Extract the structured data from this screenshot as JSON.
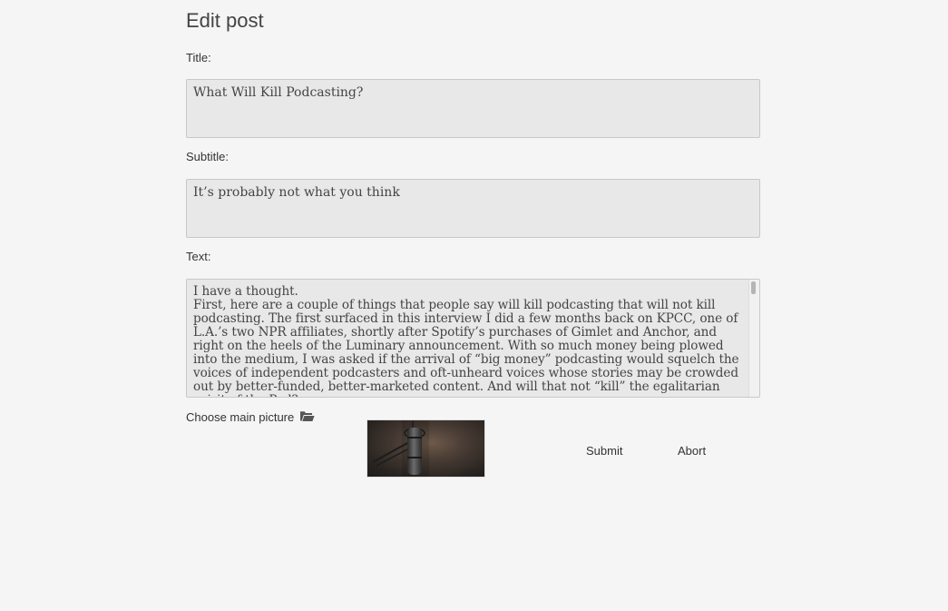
{
  "page": {
    "title": "Edit post"
  },
  "form": {
    "title_label": "Title:",
    "title_value": "What Will Kill Podcasting?",
    "subtitle_label": "Subtitle:",
    "subtitle_value": "It’s probably not what you think",
    "text_label": "Text:",
    "text_lines": [
      "I have a thought.",
      "First, here are a couple of things that people say will kill podcasting that will not kill podcasting. The first surfaced in this interview I did a few months back on KPCC, one of L.A.’s two NPR affiliates, shortly after Spotify’s purchases of Gimlet and Anchor, and right on the heels of the Luminary announcement. With so much money being plowed into the medium, I was asked if the arrival of “big money” podcasting would squelch the voices of independent podcasters and oft-unheard voices whose stories may be crowded out by better-funded, better-marketed content. And will that not “kill” the egalitarian spirit of the Pod?"
    ],
    "choose_picture_label": "Choose main picture",
    "folder_icon": "folder-open-icon",
    "submit_label": "Submit",
    "abort_label": "Abort"
  },
  "colors": {
    "background": "#f5f5f5",
    "field_background": "#e8e8e8",
    "field_border": "#c8c8c8"
  }
}
